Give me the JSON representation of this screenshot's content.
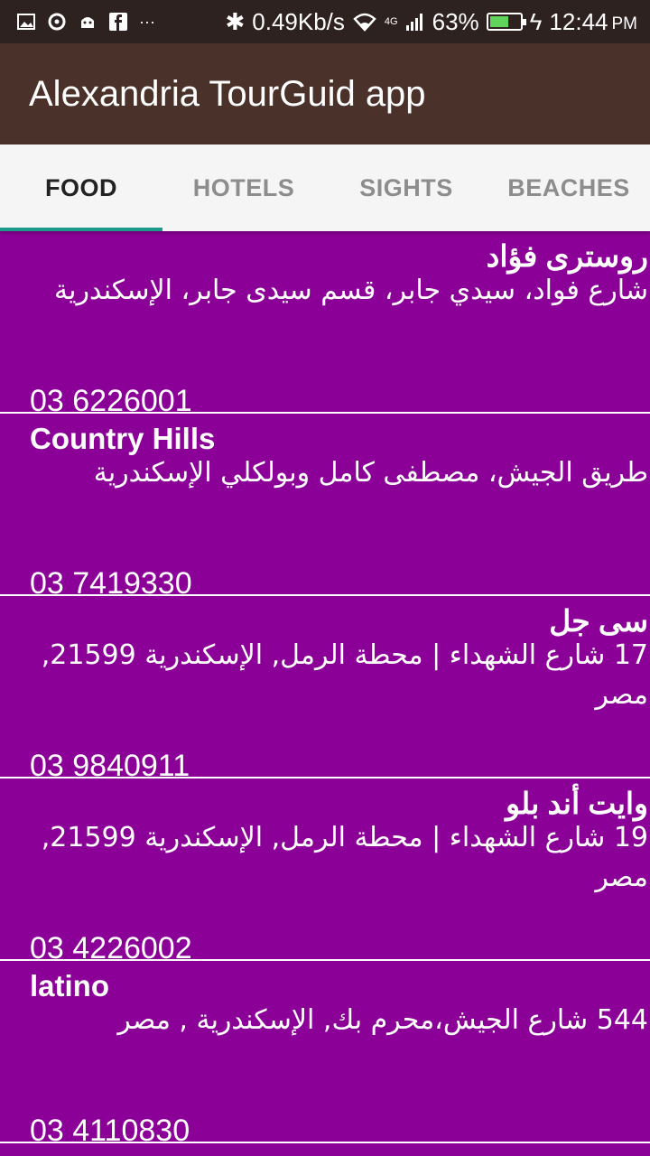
{
  "status_bar": {
    "speed": "0.49Kb/s",
    "network": "4G",
    "battery": "63%",
    "battery_level": 0.63,
    "time": "12:44",
    "ampm": "PM",
    "icons": [
      "image-icon",
      "sync-icon",
      "android-icon",
      "facebook-icon",
      "more-icon",
      "bluetooth-icon",
      "wifi-icon",
      "signal-icon",
      "battery-icon",
      "charging-icon"
    ]
  },
  "app_bar": {
    "title": "Alexandria TourGuid app"
  },
  "tabs": [
    {
      "label": "FOOD",
      "active": true
    },
    {
      "label": "HOTELS",
      "active": false
    },
    {
      "label": "SIGHTS",
      "active": false
    },
    {
      "label": "BEACHES",
      "active": false
    }
  ],
  "places": [
    {
      "name": "روسترى فؤاد",
      "address": "شارع فواد، سيدي جابر، قسم سيدى جابر، الإسكندرية",
      "phone": "03 6226001"
    },
    {
      "name": "Country Hills",
      "address": "طريق الجيش، مصطفى كامل وبولكلي الإسكندرية",
      "phone": "03 7419330"
    },
    {
      "name": "سى جل",
      "address": "17 شارع الشهداء | محطة الرمل, الإسكندرية 21599, مصر",
      "phone": "03 9840911"
    },
    {
      "name": "وايت أند بلو",
      "address": "19 شارع الشهداء | محطة الرمل, الإسكندرية 21599, مصر",
      "phone": "03 4226002"
    },
    {
      "name": "latino",
      "address": "544 شارع الجيش،محرم بك, الإسكندرية , مصر",
      "phone": "03 4110830"
    }
  ],
  "colors": {
    "list_background": "#8b0097",
    "app_bar": "#4a322b",
    "status_bar": "#2e2220",
    "tab_indicator": "#1e9a8c"
  }
}
